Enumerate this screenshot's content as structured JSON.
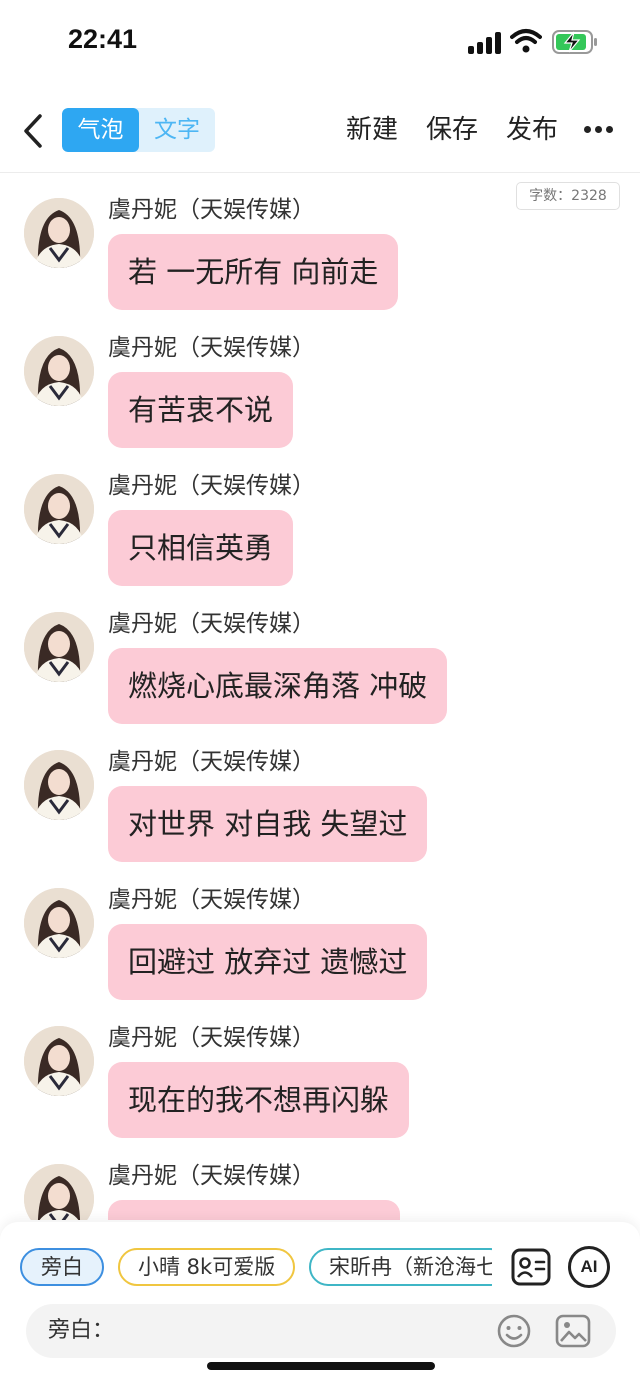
{
  "status_bar": {
    "time": "22:41"
  },
  "nav": {
    "mode_bubble": "气泡",
    "mode_text": "文字",
    "new_label": "新建",
    "save_label": "保存",
    "publish_label": "发布"
  },
  "word_count": "字数：2328",
  "messages": [
    {
      "sender": "虞丹妮（天娱传媒）",
      "text": "若 一无所有 向前走"
    },
    {
      "sender": "虞丹妮（天娱传媒）",
      "text": "有苦衷不说"
    },
    {
      "sender": "虞丹妮（天娱传媒）",
      "text": "只相信英勇"
    },
    {
      "sender": "虞丹妮（天娱传媒）",
      "text": "燃烧心底最深角落 冲破"
    },
    {
      "sender": "虞丹妮（天娱传媒）",
      "text": "对世界 对自我 失望过"
    },
    {
      "sender": "虞丹妮（天娱传媒）",
      "text": "回避过 放弃过 遗憾过"
    },
    {
      "sender": "虞丹妮（天娱传媒）",
      "text": "现在的我不想再闪躲"
    },
    {
      "sender": "虞丹妮（天娱传媒）",
      "text": ""
    }
  ],
  "roles": [
    {
      "label": "旁白"
    },
    {
      "label": "小晴 8k可爱版"
    },
    {
      "label": "宋昕冉（新沧海七"
    }
  ],
  "ai_label": "AI",
  "input": {
    "label": "旁白："
  },
  "colors": {
    "accent": "#2ea7f2",
    "bubble": "#fccbd6"
  }
}
